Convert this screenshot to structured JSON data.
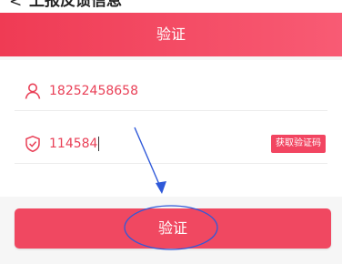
{
  "topbar": {
    "back_glyph": "<",
    "title": "上报反馈信息"
  },
  "header": {
    "title": "验证"
  },
  "form": {
    "phone": {
      "value": "18252458658",
      "icon": "user-icon"
    },
    "code": {
      "value": "114584",
      "icon": "shield-check-icon",
      "get_code_label": "获取验证码"
    }
  },
  "submit": {
    "label": "验证"
  },
  "colors": {
    "accent": "#f04861",
    "annotation": "#2f59d9"
  }
}
